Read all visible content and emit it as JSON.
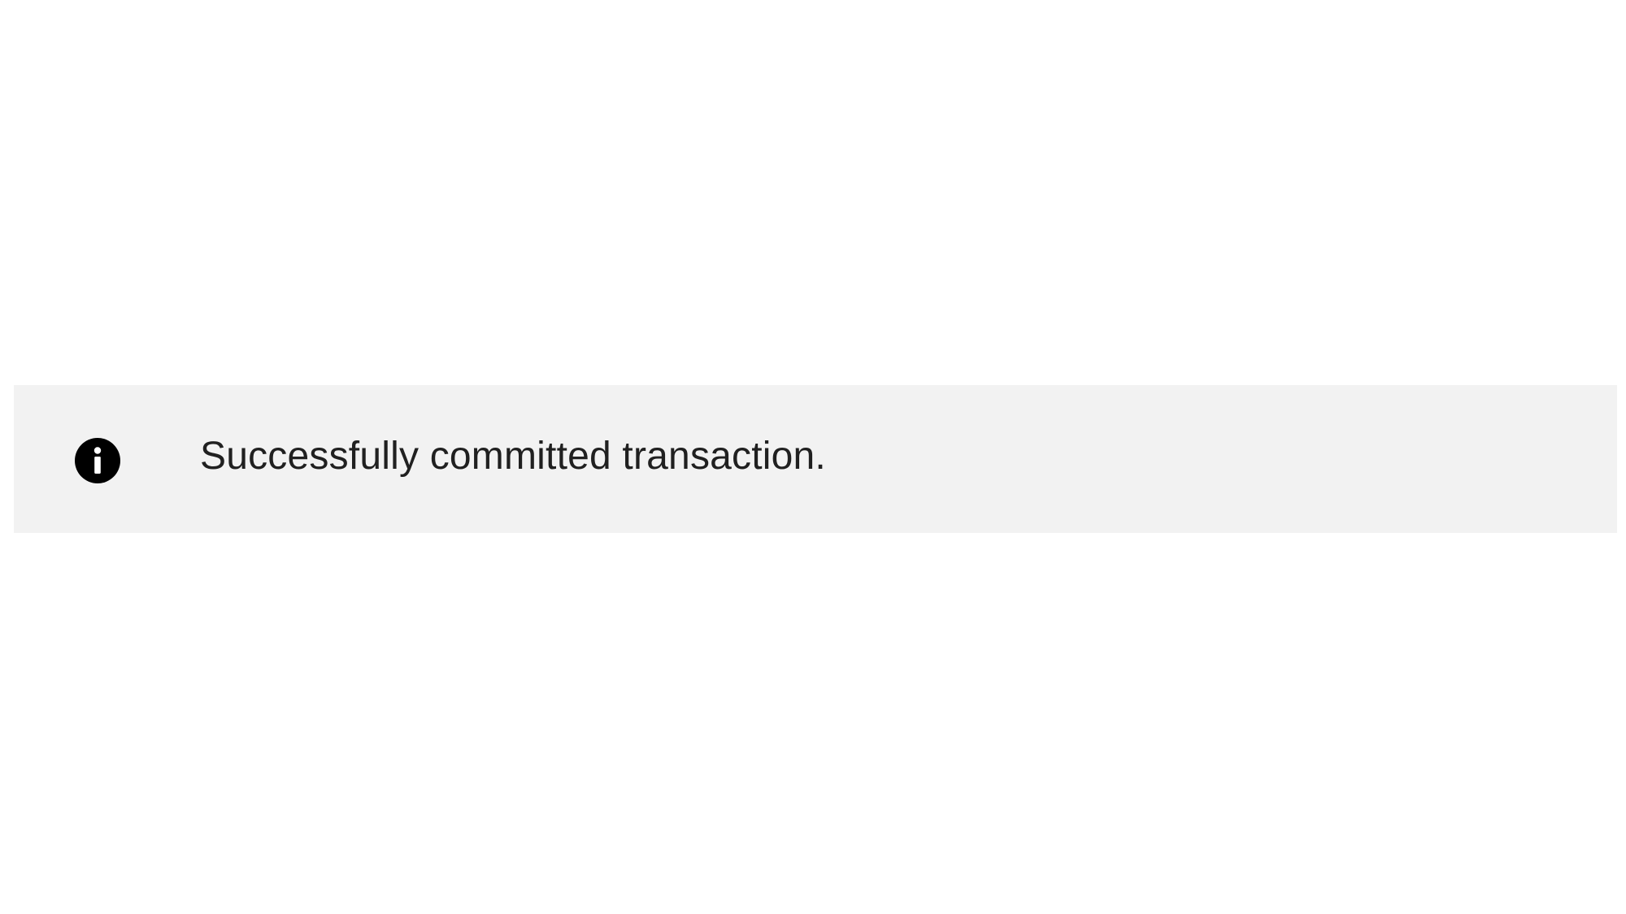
{
  "notification": {
    "message": "Successfully committed transaction.",
    "icon": "info-icon",
    "background_color": "#f2f2f2",
    "text_color": "#202020",
    "icon_color": "#000000"
  }
}
